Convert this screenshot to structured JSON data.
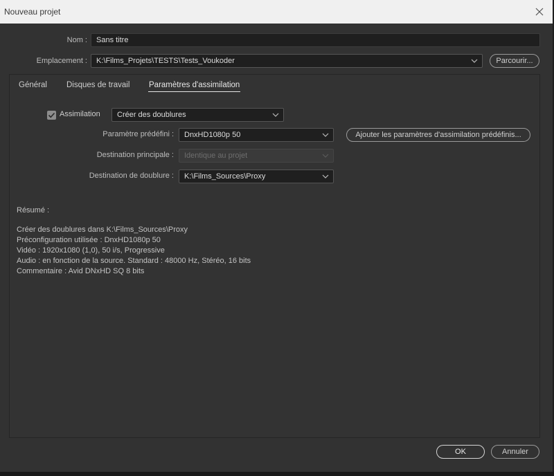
{
  "window": {
    "title": "Nouveau projet"
  },
  "name_row": {
    "label": "Nom :",
    "value": "Sans titre"
  },
  "location_row": {
    "label": "Emplacement :",
    "value": "K:\\Films_Projets\\TESTS\\Tests_Voukoder",
    "browse_label": "Parcourir..."
  },
  "tabs": [
    {
      "label": "Général"
    },
    {
      "label": "Disques de travail"
    },
    {
      "label": "Paramètres d'assimilation",
      "active": true
    }
  ],
  "ingest": {
    "checkbox_label": "Assimilation",
    "checked": true,
    "mode_value": "Créer des doublures",
    "preset_label": "Paramètre prédéfini :",
    "preset_value": "DnxHD1080p 50",
    "add_preset_button": "Ajouter les paramètres d'assimilation prédéfinis...",
    "primary_dest_label": "Destination principale :",
    "primary_dest_value": "Identique au projet",
    "proxy_dest_label": "Destination de doublure :",
    "proxy_dest_value": "K:\\Films_Sources\\Proxy"
  },
  "summary": {
    "heading": "Résumé :",
    "lines": [
      "Créer des doublures dans K:\\Films_Sources\\Proxy",
      "Préconfiguration utilisée : DnxHD1080p 50",
      "Vidéo : 1920x1080 (1,0), 50 i/s, Progressive",
      "Audio : en fonction de la source. Standard : 48000 Hz, Stéréo, 16 bits",
      "Commentaire : Avid DNxHD SQ 8 bits"
    ]
  },
  "footer": {
    "ok_label": "OK",
    "cancel_label": "Annuler"
  },
  "icons": {
    "close": "close-icon",
    "chevron": "chevron-down-icon",
    "check": "checkmark-icon"
  },
  "colors": {
    "dialog_bg": "#323232",
    "titlebar_bg": "#f0f0f0",
    "field_bg": "#1f1f1f"
  }
}
